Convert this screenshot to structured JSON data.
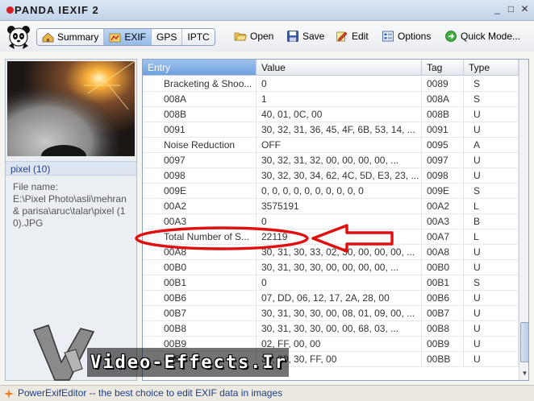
{
  "window": {
    "title": "PANDA IEXIF 2",
    "controls": [
      "_",
      "□",
      "✕"
    ]
  },
  "toolbar": {
    "tabs": [
      {
        "label": "Summary",
        "icon": "house-icon",
        "active": false
      },
      {
        "label": "EXIF",
        "icon": "exif-icon",
        "active": true
      },
      {
        "label": "GPS",
        "icon": "",
        "active": false
      },
      {
        "label": "IPTC",
        "icon": "",
        "active": false
      }
    ],
    "tools": [
      {
        "label": "Open",
        "icon": "folder-open-icon"
      },
      {
        "label": "Save",
        "icon": "save-icon"
      },
      {
        "label": "Edit",
        "icon": "edit-icon"
      },
      {
        "label": "Options",
        "icon": "options-icon"
      },
      {
        "label": "Quick Mode...",
        "icon": "quick-mode-icon"
      }
    ]
  },
  "left_panel": {
    "image_title": "pixel (10)",
    "file_name_label": "File name:",
    "file_path": "E:\\Pixel Photo\\asli\\mehran & parisa\\aruc\\talar\\pixel (10).JPG"
  },
  "grid": {
    "columns": [
      "Entry",
      "Value",
      "Tag",
      "Type"
    ],
    "rows": [
      {
        "entry": "Bracketing & Shoo...",
        "value": "0",
        "tag": "0089",
        "type": "S"
      },
      {
        "entry": "008A",
        "value": "1",
        "tag": "008A",
        "type": "S"
      },
      {
        "entry": "008B",
        "value": "40, 01, 0C, 00",
        "tag": "008B",
        "type": "U"
      },
      {
        "entry": "0091",
        "value": "30, 32, 31, 36, 45, 4F, 6B, 53, 14, ...",
        "tag": "0091",
        "type": "U"
      },
      {
        "entry": "Noise Reduction",
        "value": "OFF",
        "tag": "0095",
        "type": "A"
      },
      {
        "entry": "0097",
        "value": "30, 32, 31, 32, 00, 00, 00, 00, ...",
        "tag": "0097",
        "type": "U"
      },
      {
        "entry": "0098",
        "value": "30, 32, 30, 34, 62, 4C, 5D, E3, 23, ...",
        "tag": "0098",
        "type": "U"
      },
      {
        "entry": "009E",
        "value": "0, 0, 0, 0, 0, 0, 0, 0, 0, 0",
        "tag": "009E",
        "type": "S"
      },
      {
        "entry": "00A2",
        "value": "3575191",
        "tag": "00A2",
        "type": "L"
      },
      {
        "entry": "00A3",
        "value": "0",
        "tag": "00A3",
        "type": "B"
      },
      {
        "entry": "Total Number of S...",
        "value": "22119",
        "tag": "00A7",
        "type": "L"
      },
      {
        "entry": "00A8",
        "value": "30, 31, 30, 33, 02, 30, 00, 00, 00, ...",
        "tag": "00A8",
        "type": "U"
      },
      {
        "entry": "00B0",
        "value": "30, 31, 30, 30, 00, 00, 00, 00, ...",
        "tag": "00B0",
        "type": "U"
      },
      {
        "entry": "00B1",
        "value": "0",
        "tag": "00B1",
        "type": "S"
      },
      {
        "entry": "00B6",
        "value": "07, DD, 06, 12, 17, 2A, 28, 00",
        "tag": "00B6",
        "type": "U"
      },
      {
        "entry": "00B7",
        "value": "30, 31, 30, 30, 00, 08, 01, 09, 00, ...",
        "tag": "00B7",
        "type": "U"
      },
      {
        "entry": "00B8",
        "value": "30, 31, 30, 30, 00, 00, 68, 03, ...",
        "tag": "00B8",
        "type": "U"
      },
      {
        "entry": "00B9",
        "value": "02, FF, 00, 00",
        "tag": "00B9",
        "type": "U"
      },
      {
        "entry": "00BB",
        "value": "30, 30, 30, FF, 00",
        "tag": "00BB",
        "type": "U"
      }
    ]
  },
  "watermark": {
    "text": "Video-Effects.Ir"
  },
  "status": {
    "text": "PowerExifEditor -- the best choice to edit EXIF data in images"
  },
  "colors": {
    "annotation": "#e01010",
    "selected_header": "#6fa0de",
    "status_text": "#1d3f87"
  }
}
